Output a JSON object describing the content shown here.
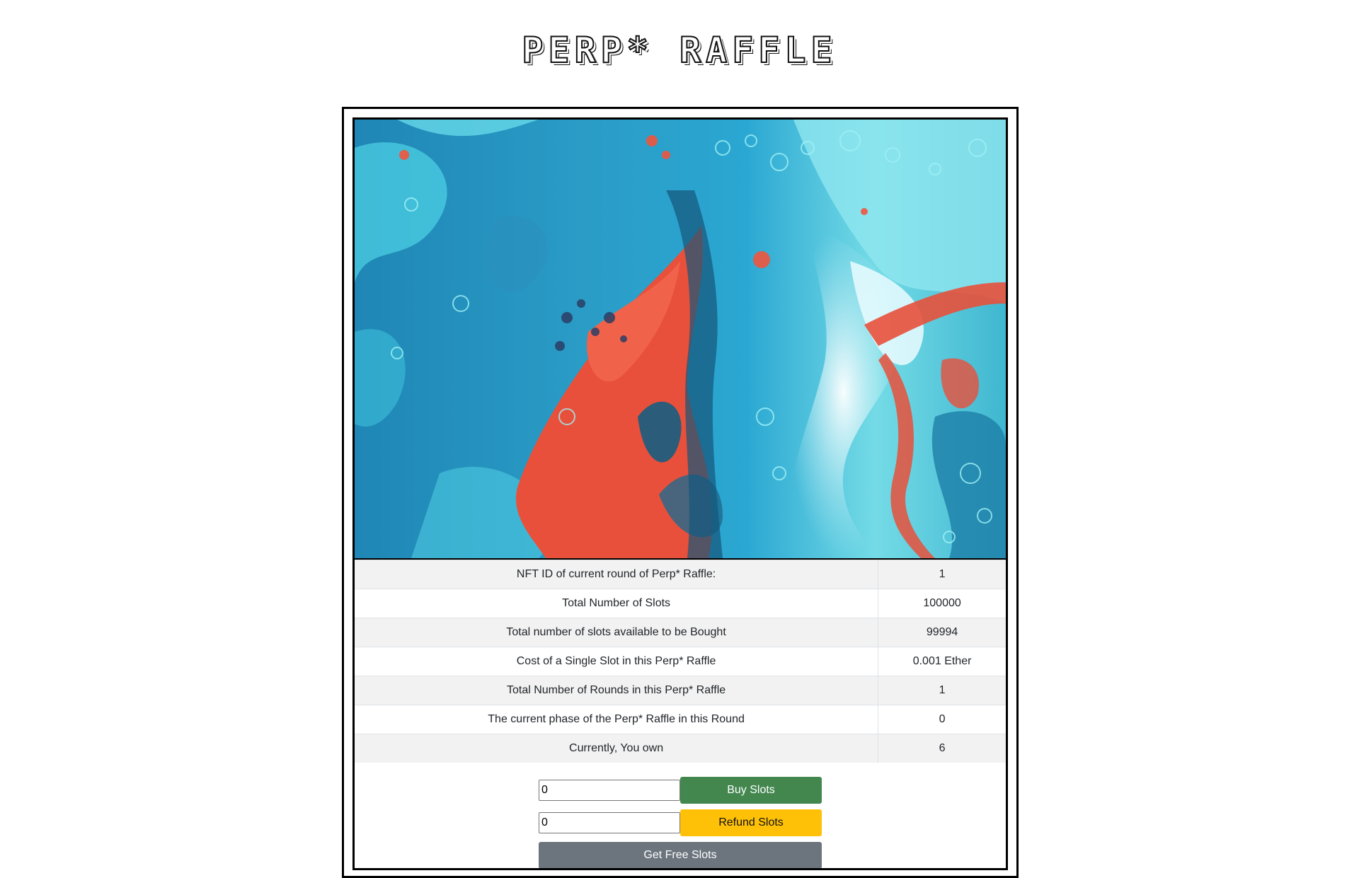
{
  "header": {
    "title": "Perp* Raffle"
  },
  "info_table": {
    "rows": [
      {
        "label": "NFT ID of current round of Perp* Raffle:",
        "value": "1"
      },
      {
        "label": "Total Number of Slots",
        "value": "100000"
      },
      {
        "label": "Total number of slots available to be Bought",
        "value": "99994"
      },
      {
        "label": "Cost of a Single Slot in this Perp* Raffle",
        "value": "0.001 Ether"
      },
      {
        "label": "Total Number of Rounds in this Perp* Raffle",
        "value": "1"
      },
      {
        "label": "The current phase of the Perp* Raffle in this Round",
        "value": "0"
      },
      {
        "label": "Currently, You own",
        "value": "6"
      }
    ]
  },
  "controls": {
    "buy_input_value": "0",
    "buy_button_label": "Buy Slots",
    "refund_input_value": "0",
    "refund_button_label": "Refund Slots",
    "free_button_label": "Get Free Slots"
  },
  "colors": {
    "buy_button": "#43874f",
    "refund_button": "#ffc107",
    "free_button": "#6c757d",
    "art_blue": "#2a9cc6",
    "art_cyan": "#5fe0ea",
    "art_red": "#f0553e"
  }
}
